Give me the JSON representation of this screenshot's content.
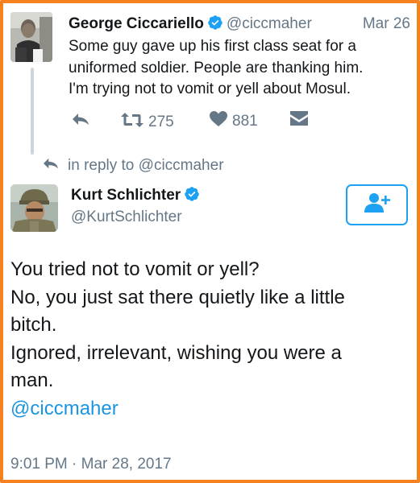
{
  "parent_tweet": {
    "author_name": "George Ciccariello",
    "handle": "@ciccmaher",
    "date": "Mar 26",
    "text_lines": [
      "Some guy gave up his first class seat for a",
      "uniformed soldier. People are thanking him.",
      "I'm trying not to vomit or yell about Mosul."
    ],
    "retweet_count": "275",
    "like_count": "881"
  },
  "reply_context": {
    "text": "in reply to @ciccmaher"
  },
  "main_tweet": {
    "author_name": "Kurt Schlichter",
    "handle": "@KurtSchlichter",
    "text_lines": [
      "You tried not to vomit or yell?",
      "No, you just sat there quietly like a little",
      "bitch.",
      "Ignored, irrelevant, wishing you were a",
      "man."
    ],
    "mention": "@ciccmaher",
    "timestamp": "9:01 PM · Mar 28, 2017"
  },
  "icons": {
    "verified": "verified-badge-icon",
    "reply": "reply-icon",
    "retweet": "retweet-icon",
    "like": "heart-icon",
    "dm": "direct-message-icon",
    "follow": "add-user-icon"
  },
  "colors": {
    "frame": "#f5821f",
    "link": "#1b95e0",
    "verified": "#1da1f2",
    "secondary_text": "#657786"
  }
}
